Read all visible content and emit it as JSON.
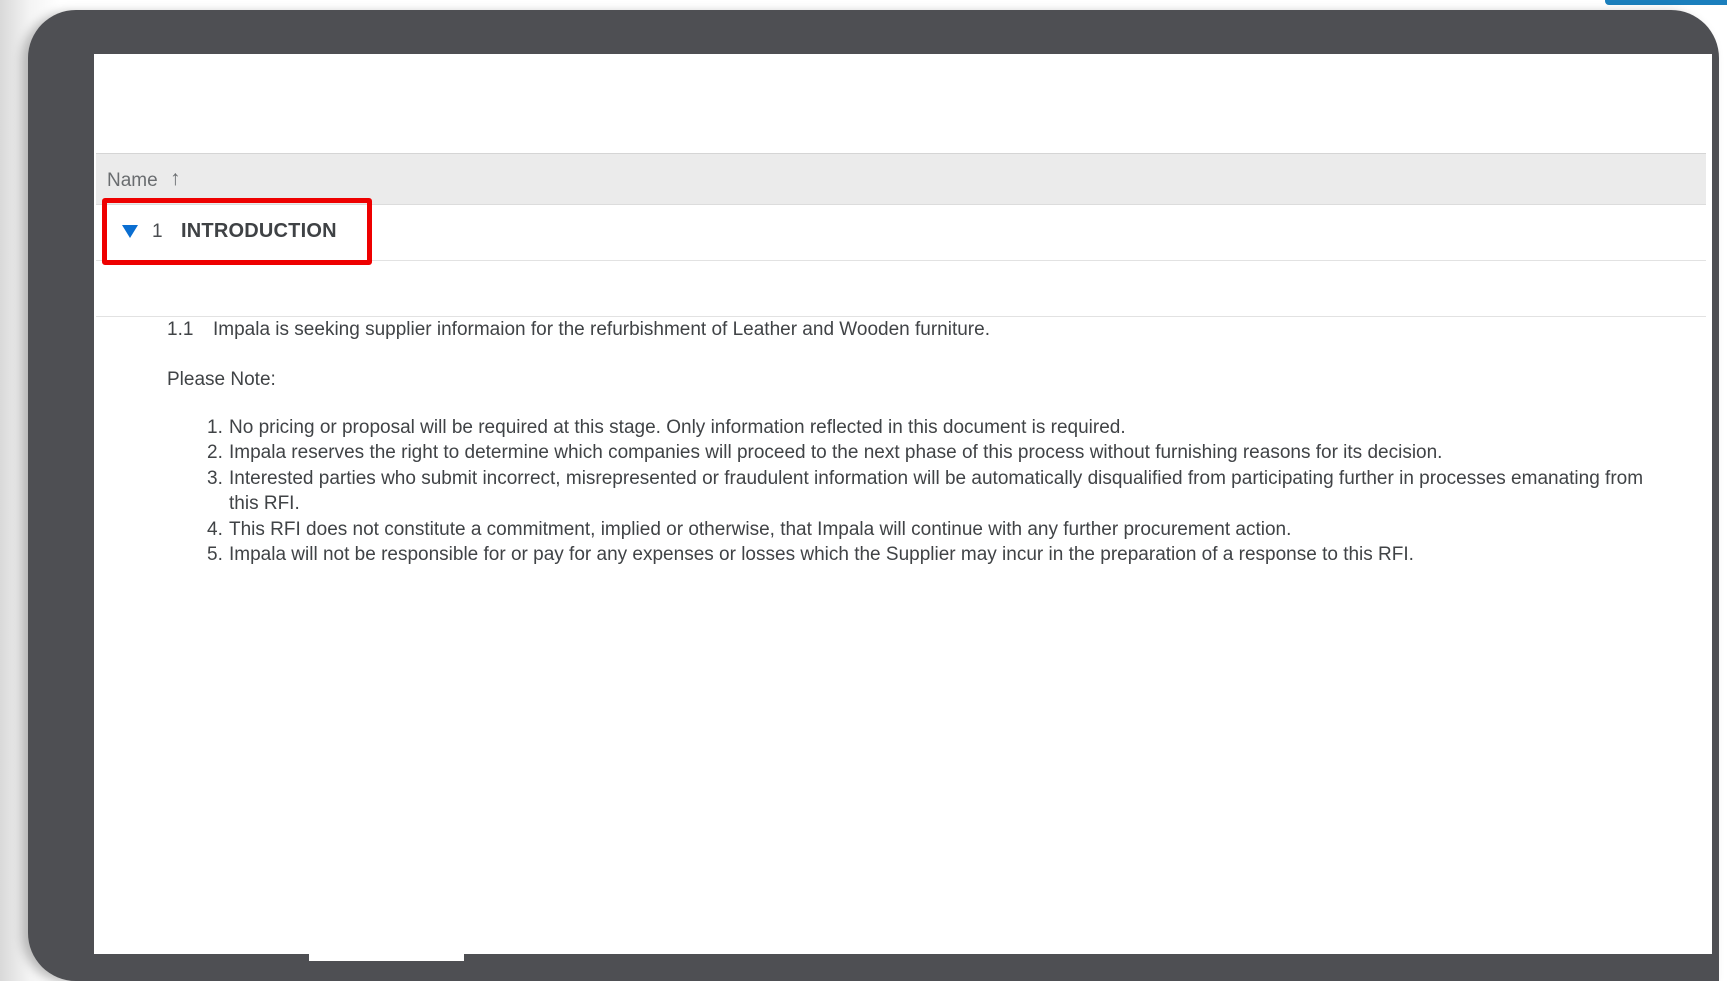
{
  "colors": {
    "device_frame": "#4e4f53",
    "accent": "#1b7fbd",
    "highlight": "#ee0000",
    "expand_icon": "#0a6ed1",
    "header_bg": "#ebebeb"
  },
  "table": {
    "column_name": "Name",
    "sort_icon": "arrow-up-icon",
    "sort_glyph": "↑"
  },
  "section": {
    "number": "1",
    "title": "INTRODUCTION",
    "expand_icon": "triangle-down-icon"
  },
  "content": {
    "item_number": "1.1",
    "item_text": "Impala is seeking supplier informaion for the refurbishment of Leather and Wooden furniture.",
    "note_label": "Please Note:",
    "notes": [
      {
        "num": "1.",
        "text": "No pricing or proposal will be required at this stage. Only information reflected in this document is required."
      },
      {
        "num": "2.",
        "text": "Impala reserves the right to determine which companies will proceed to the next phase of this process without furnishing reasons for its decision."
      },
      {
        "num": "3.",
        "text": "Interested parties who submit incorrect, misrepresented or fraudulent information will be automatically disqualified from participating further in processes emanating from this RFI."
      },
      {
        "num": "4.",
        "text": "This RFI does not constitute a commitment, implied or otherwise, that Impala will continue with any further procurement action."
      },
      {
        "num": "5.",
        "text": "Impala will not be responsible for or pay for any expenses or losses which the Supplier may incur in the preparation of a response to this RFI."
      }
    ]
  }
}
